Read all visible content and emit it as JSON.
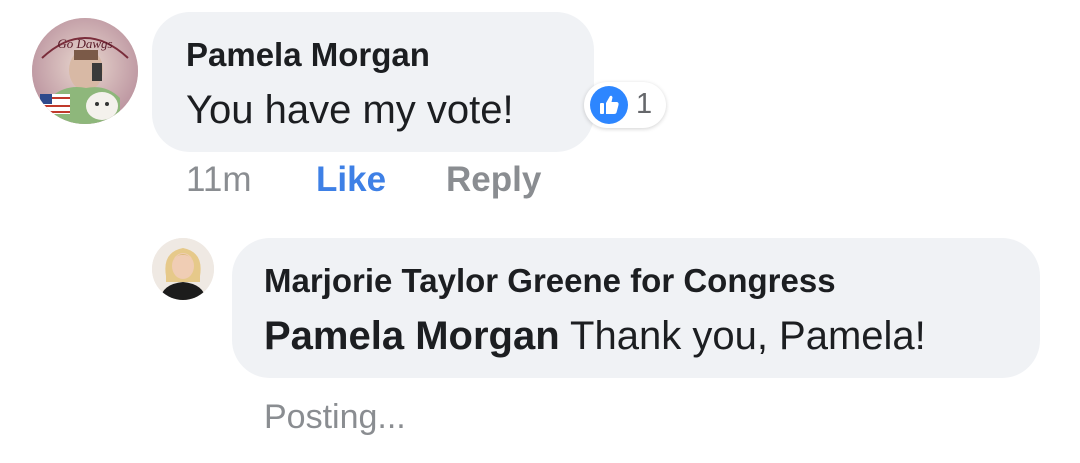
{
  "comment": {
    "author": "Pamela Morgan",
    "text": "You have my vote!",
    "time": "11m",
    "like_label": "Like",
    "reply_label": "Reply",
    "avatar_text": "Go Dawgs",
    "reaction": {
      "icon": "thumbs-up-icon",
      "count": "1",
      "color": "#2d86ff"
    }
  },
  "reply": {
    "author": "Marjorie Taylor Greene for Congress",
    "mention": "Pamela Morgan",
    "text": "Thank you, Pamela!",
    "status": "Posting..."
  },
  "colors": {
    "bubble": "#f0f2f5",
    "link_blue": "#3e80e6",
    "meta_gray": "#8a8d91",
    "text": "#1c1e21"
  }
}
